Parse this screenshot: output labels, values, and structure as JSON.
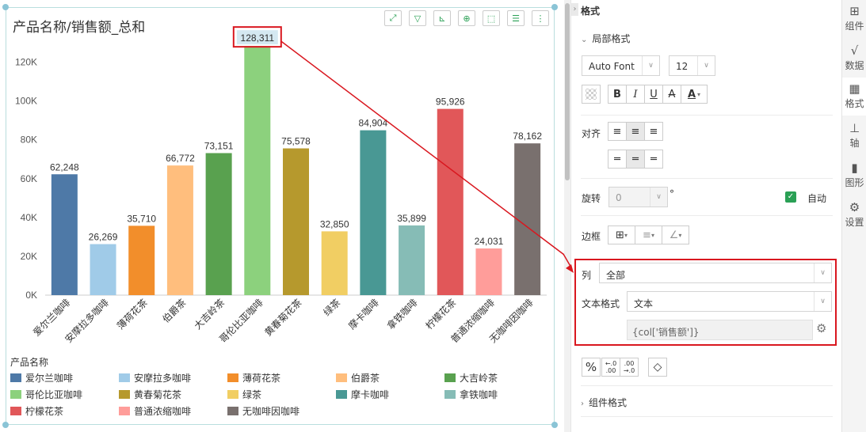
{
  "chart": {
    "title": "产品名称/销售额_总和",
    "toolbar": [
      "expand-icon",
      "filter-icon",
      "axis-icon",
      "zoom-icon",
      "select-icon",
      "list-icon",
      "more-icon"
    ],
    "highlight_color": "#d9171f"
  },
  "chart_data": {
    "type": "bar",
    "categories": [
      "爱尔兰咖啡",
      "安摩拉多咖啡",
      "薄荷花茶",
      "伯爵茶",
      "大吉岭茶",
      "哥伦比亚咖啡",
      "黄春菊花茶",
      "绿茶",
      "摩卡咖啡",
      "拿铁咖啡",
      "柠檬花茶",
      "普通浓缩咖啡",
      "无咖啡因咖啡"
    ],
    "values": [
      62248,
      26269,
      35710,
      66772,
      73151,
      128311,
      75578,
      32850,
      84904,
      35899,
      95926,
      24031,
      78162
    ],
    "value_labels": [
      "62,248",
      "26,269",
      "35,710",
      "66,772",
      "73,151",
      "128,311",
      "75,578",
      "32,850",
      "84,904",
      "35,899",
      "95,926",
      "24,031",
      "78,162"
    ],
    "colors": [
      "#4e79a7",
      "#a0cbe8",
      "#f28e2b",
      "#ffbe7d",
      "#59a14f",
      "#8cd17d",
      "#b6992d",
      "#f1ce63",
      "#499894",
      "#86bcb6",
      "#e15759",
      "#ff9d9a",
      "#79706e"
    ],
    "ylim": [
      0,
      130000
    ],
    "yticks": [
      0,
      20000,
      40000,
      60000,
      80000,
      100000,
      120000
    ],
    "ytick_labels": [
      "0K",
      "20K",
      "40K",
      "60K",
      "80K",
      "100K",
      "120K"
    ],
    "grid": false,
    "legend_title": "产品名称",
    "legend_position": "bottom"
  },
  "panel": {
    "title": "格式",
    "local_format": "局部格式",
    "font_name": "Auto Font",
    "font_size": "12",
    "style_buttons": [
      "B",
      "I",
      "U",
      "A",
      "A"
    ],
    "align_label": "对齐",
    "rotate_label": "旋转",
    "rotate_value": "0",
    "rotate_unit": "°",
    "auto_label": "自动",
    "border_label": "边框",
    "column_label": "列",
    "column_value": "全部",
    "text_format_label": "文本格式",
    "text_format_value": "文本",
    "text_expression": "{col['销售额']}",
    "component_format": "组件格式"
  },
  "nav": {
    "items": [
      {
        "label": "组件",
        "icon": "component-icon"
      },
      {
        "label": "数据",
        "icon": "data-icon"
      },
      {
        "label": "格式",
        "icon": "format-icon"
      },
      {
        "label": "轴",
        "icon": "axis-icon"
      },
      {
        "label": "图形",
        "icon": "graph-icon"
      },
      {
        "label": "设置",
        "icon": "settings-icon"
      }
    ]
  }
}
